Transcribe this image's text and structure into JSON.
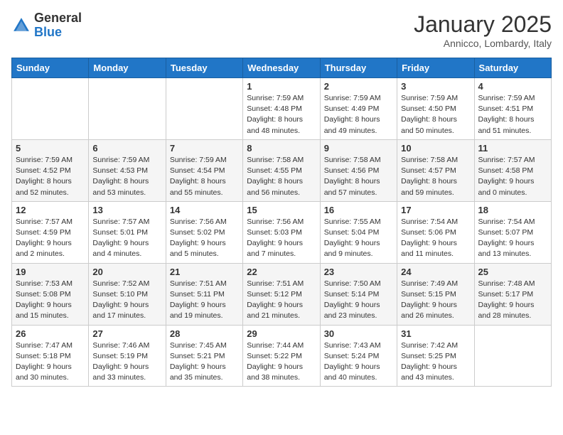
{
  "header": {
    "logo_general": "General",
    "logo_blue": "Blue",
    "month": "January 2025",
    "location": "Annicco, Lombardy, Italy"
  },
  "days_of_week": [
    "Sunday",
    "Monday",
    "Tuesday",
    "Wednesday",
    "Thursday",
    "Friday",
    "Saturday"
  ],
  "weeks": [
    [
      {
        "day": "",
        "info": ""
      },
      {
        "day": "",
        "info": ""
      },
      {
        "day": "",
        "info": ""
      },
      {
        "day": "1",
        "info": "Sunrise: 7:59 AM\nSunset: 4:48 PM\nDaylight: 8 hours\nand 48 minutes."
      },
      {
        "day": "2",
        "info": "Sunrise: 7:59 AM\nSunset: 4:49 PM\nDaylight: 8 hours\nand 49 minutes."
      },
      {
        "day": "3",
        "info": "Sunrise: 7:59 AM\nSunset: 4:50 PM\nDaylight: 8 hours\nand 50 minutes."
      },
      {
        "day": "4",
        "info": "Sunrise: 7:59 AM\nSunset: 4:51 PM\nDaylight: 8 hours\nand 51 minutes."
      }
    ],
    [
      {
        "day": "5",
        "info": "Sunrise: 7:59 AM\nSunset: 4:52 PM\nDaylight: 8 hours\nand 52 minutes."
      },
      {
        "day": "6",
        "info": "Sunrise: 7:59 AM\nSunset: 4:53 PM\nDaylight: 8 hours\nand 53 minutes."
      },
      {
        "day": "7",
        "info": "Sunrise: 7:59 AM\nSunset: 4:54 PM\nDaylight: 8 hours\nand 55 minutes."
      },
      {
        "day": "8",
        "info": "Sunrise: 7:58 AM\nSunset: 4:55 PM\nDaylight: 8 hours\nand 56 minutes."
      },
      {
        "day": "9",
        "info": "Sunrise: 7:58 AM\nSunset: 4:56 PM\nDaylight: 8 hours\nand 57 minutes."
      },
      {
        "day": "10",
        "info": "Sunrise: 7:58 AM\nSunset: 4:57 PM\nDaylight: 8 hours\nand 59 minutes."
      },
      {
        "day": "11",
        "info": "Sunrise: 7:57 AM\nSunset: 4:58 PM\nDaylight: 9 hours\nand 0 minutes."
      }
    ],
    [
      {
        "day": "12",
        "info": "Sunrise: 7:57 AM\nSunset: 4:59 PM\nDaylight: 9 hours\nand 2 minutes."
      },
      {
        "day": "13",
        "info": "Sunrise: 7:57 AM\nSunset: 5:01 PM\nDaylight: 9 hours\nand 4 minutes."
      },
      {
        "day": "14",
        "info": "Sunrise: 7:56 AM\nSunset: 5:02 PM\nDaylight: 9 hours\nand 5 minutes."
      },
      {
        "day": "15",
        "info": "Sunrise: 7:56 AM\nSunset: 5:03 PM\nDaylight: 9 hours\nand 7 minutes."
      },
      {
        "day": "16",
        "info": "Sunrise: 7:55 AM\nSunset: 5:04 PM\nDaylight: 9 hours\nand 9 minutes."
      },
      {
        "day": "17",
        "info": "Sunrise: 7:54 AM\nSunset: 5:06 PM\nDaylight: 9 hours\nand 11 minutes."
      },
      {
        "day": "18",
        "info": "Sunrise: 7:54 AM\nSunset: 5:07 PM\nDaylight: 9 hours\nand 13 minutes."
      }
    ],
    [
      {
        "day": "19",
        "info": "Sunrise: 7:53 AM\nSunset: 5:08 PM\nDaylight: 9 hours\nand 15 minutes."
      },
      {
        "day": "20",
        "info": "Sunrise: 7:52 AM\nSunset: 5:10 PM\nDaylight: 9 hours\nand 17 minutes."
      },
      {
        "day": "21",
        "info": "Sunrise: 7:51 AM\nSunset: 5:11 PM\nDaylight: 9 hours\nand 19 minutes."
      },
      {
        "day": "22",
        "info": "Sunrise: 7:51 AM\nSunset: 5:12 PM\nDaylight: 9 hours\nand 21 minutes."
      },
      {
        "day": "23",
        "info": "Sunrise: 7:50 AM\nSunset: 5:14 PM\nDaylight: 9 hours\nand 23 minutes."
      },
      {
        "day": "24",
        "info": "Sunrise: 7:49 AM\nSunset: 5:15 PM\nDaylight: 9 hours\nand 26 minutes."
      },
      {
        "day": "25",
        "info": "Sunrise: 7:48 AM\nSunset: 5:17 PM\nDaylight: 9 hours\nand 28 minutes."
      }
    ],
    [
      {
        "day": "26",
        "info": "Sunrise: 7:47 AM\nSunset: 5:18 PM\nDaylight: 9 hours\nand 30 minutes."
      },
      {
        "day": "27",
        "info": "Sunrise: 7:46 AM\nSunset: 5:19 PM\nDaylight: 9 hours\nand 33 minutes."
      },
      {
        "day": "28",
        "info": "Sunrise: 7:45 AM\nSunset: 5:21 PM\nDaylight: 9 hours\nand 35 minutes."
      },
      {
        "day": "29",
        "info": "Sunrise: 7:44 AM\nSunset: 5:22 PM\nDaylight: 9 hours\nand 38 minutes."
      },
      {
        "day": "30",
        "info": "Sunrise: 7:43 AM\nSunset: 5:24 PM\nDaylight: 9 hours\nand 40 minutes."
      },
      {
        "day": "31",
        "info": "Sunrise: 7:42 AM\nSunset: 5:25 PM\nDaylight: 9 hours\nand 43 minutes."
      },
      {
        "day": "",
        "info": ""
      }
    ]
  ]
}
